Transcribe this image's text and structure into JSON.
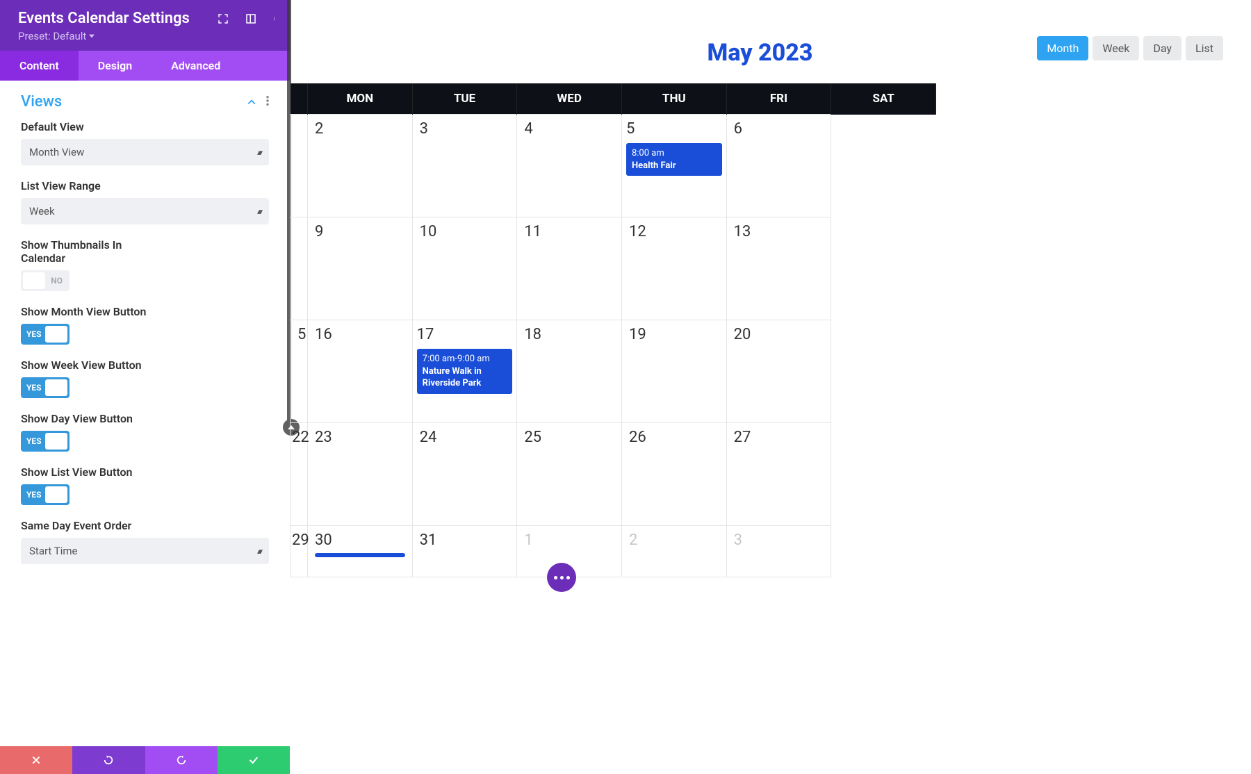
{
  "panel": {
    "title": "Events Calendar Settings",
    "preset_label": "Preset: Default",
    "tabs": {
      "content": "Content",
      "design": "Design",
      "advanced": "Advanced"
    },
    "section_title": "Views",
    "fields": {
      "default_view": {
        "label": "Default View",
        "value": "Month View"
      },
      "list_range": {
        "label": "List View Range",
        "value": "Week"
      },
      "thumbnails": {
        "label": "Show Thumbnails In Calendar",
        "value": "NO"
      },
      "show_month": {
        "label": "Show Month View Button",
        "value": "YES"
      },
      "show_week": {
        "label": "Show Week View Button",
        "value": "YES"
      },
      "show_day": {
        "label": "Show Day View Button",
        "value": "YES"
      },
      "show_list": {
        "label": "Show List View Button",
        "value": "YES"
      },
      "same_day": {
        "label": "Same Day Event Order",
        "value": "Start Time"
      }
    }
  },
  "calendar": {
    "title": "May 2023",
    "views": {
      "month": "Month",
      "week": "Week",
      "day": "Day",
      "list": "List"
    },
    "days": {
      "mon": "MON",
      "tue": "TUE",
      "wed": "WED",
      "thu": "THU",
      "fri": "FRI",
      "sat": "SAT"
    },
    "cells": {
      "r0c0": "2",
      "r0c1": "3",
      "r0c2": "4",
      "r0c3": "5",
      "r0c4": "6",
      "r1c0": "9",
      "r1c1": "10",
      "r1c2": "11",
      "r1c3": "12",
      "r1c4": "13",
      "r2m": "5",
      "r2c0": "16",
      "r2c1": "17",
      "r2c2": "18",
      "r2c3": "19",
      "r2c4": "20",
      "r3m": "22",
      "r3c0": "23",
      "r3c1": "24",
      "r3c2": "25",
      "r3c3": "26",
      "r3c4": "27",
      "r4m": "29",
      "r4c0": "30",
      "r4c1": "31",
      "r4c2": "1",
      "r4c3": "2",
      "r4c4": "3"
    },
    "events": {
      "e1": {
        "time": "8:00 am",
        "title": "Health Fair"
      },
      "e2": {
        "time": "7:00 am-9:00 am",
        "title": "Nature Walk in Riverside Park"
      }
    }
  }
}
